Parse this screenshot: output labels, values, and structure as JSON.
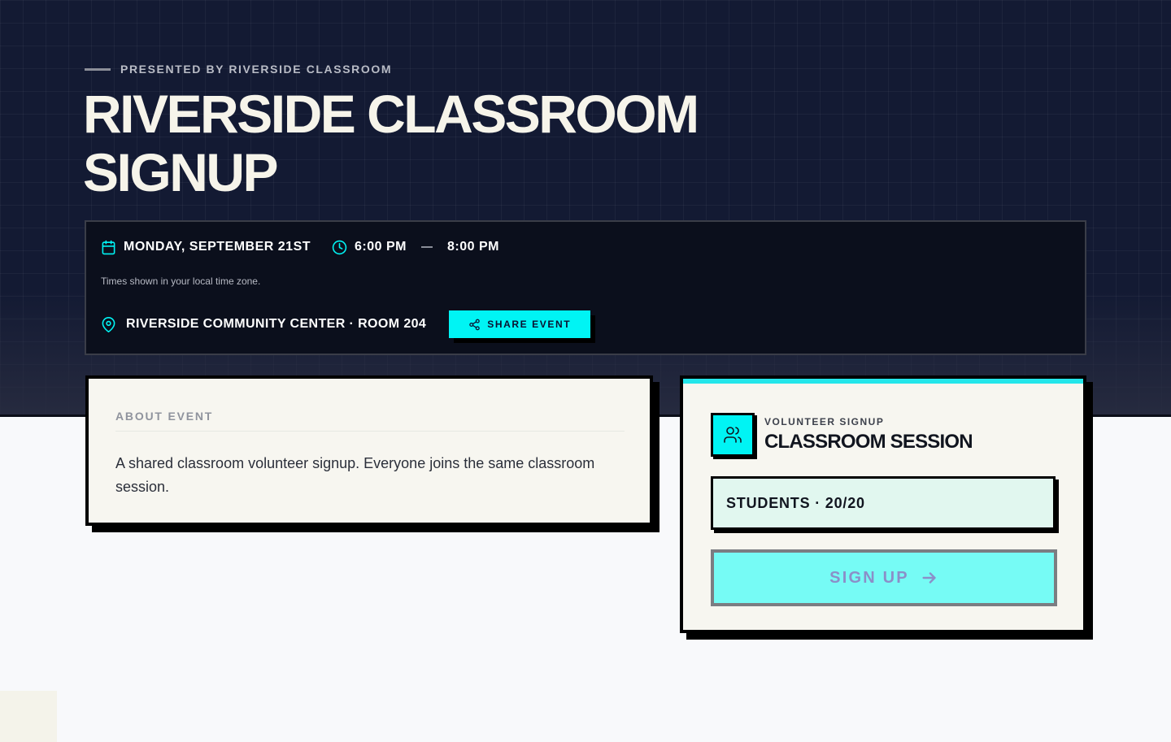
{
  "hero": {
    "presented_by": "PRESENTED BY RIVERSIDE CLASSROOM",
    "title": "RIVERSIDE CLASSROOM SIGNUP"
  },
  "event_info": {
    "date": "MONDAY, SEPTEMBER 21ST",
    "time_start": "6:00 PM",
    "time_end": "8:00 PM",
    "timezone_note": "Times shown in your local time zone.",
    "location": "RIVERSIDE COMMUNITY CENTER · ROOM 204",
    "share_label": "SHARE EVENT"
  },
  "about": {
    "label": "ABOUT EVENT",
    "description": "A shared classroom volunteer signup. Everyone joins the same classroom session."
  },
  "signup": {
    "kicker": "VOLUNTEER SIGNUP",
    "title": "CLASSROOM SESSION",
    "capacity_label": "STUDENTS · 20/20",
    "button_label": "SIGN UP"
  },
  "icons": {
    "date": "calendar-icon",
    "time": "clock-icon",
    "location": "map-pin-icon",
    "share": "share-icon",
    "volunteers": "users-icon",
    "submit": "arrow-right-icon"
  },
  "colors": {
    "hero_bg": "#131a33",
    "accent_cyan": "#00f4f4",
    "card_bg": "#f7f6f0",
    "students_bg": "#e1f7ef",
    "signup_button_bg": "#76fbf5"
  }
}
